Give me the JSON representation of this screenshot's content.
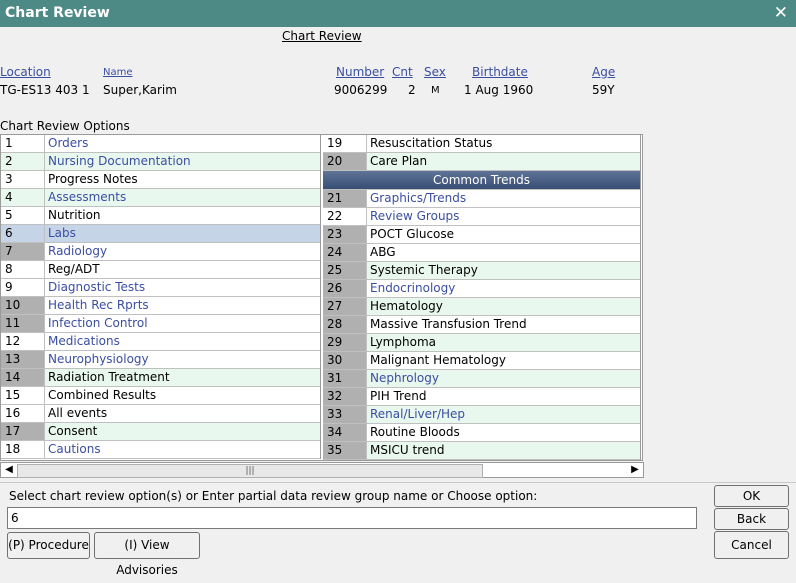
{
  "window": {
    "title": "Chart Review",
    "close_glyph": "✕"
  },
  "heading": "Chart Review",
  "patient": {
    "headers": {
      "location": "Location",
      "name": "Name",
      "number": "Number",
      "cnt": "Cnt",
      "sex": "Sex",
      "birthdate": "Birthdate",
      "age": "Age"
    },
    "values": {
      "location": "TG-ES13 403 1",
      "name": "Super,Karim",
      "number": "9006299",
      "cnt": "2",
      "sex": "M",
      "birthdate": "1 Aug 1960",
      "age": "59Y"
    }
  },
  "options_label": "Chart Review Options",
  "left_options": [
    {
      "num": "1",
      "label": "Orders",
      "link": true,
      "shade": false,
      "gray": false
    },
    {
      "num": "2",
      "label": "Nursing Documentation",
      "link": true,
      "shade": true,
      "gray": false
    },
    {
      "num": "3",
      "label": "Progress Notes",
      "link": false,
      "shade": false,
      "gray": false
    },
    {
      "num": "4",
      "label": "Assessments",
      "link": true,
      "shade": true,
      "gray": false
    },
    {
      "num": "5",
      "label": "Nutrition",
      "link": false,
      "shade": false,
      "gray": false
    },
    {
      "num": "6",
      "label": "Labs",
      "link": true,
      "shade": false,
      "gray": false,
      "selected": true
    },
    {
      "num": "7",
      "label": "Radiology",
      "link": true,
      "shade": false,
      "gray": true
    },
    {
      "num": "8",
      "label": "Reg/ADT",
      "link": false,
      "shade": false,
      "gray": false
    },
    {
      "num": "9",
      "label": "Diagnostic Tests",
      "link": true,
      "shade": false,
      "gray": false
    },
    {
      "num": "10",
      "label": "Health Rec Rprts",
      "link": true,
      "shade": false,
      "gray": true
    },
    {
      "num": "11",
      "label": "Infection Control",
      "link": true,
      "shade": false,
      "gray": true
    },
    {
      "num": "12",
      "label": "Medications",
      "link": true,
      "shade": false,
      "gray": false
    },
    {
      "num": "13",
      "label": "Neurophysiology",
      "link": true,
      "shade": false,
      "gray": true
    },
    {
      "num": "14",
      "label": "Radiation Treatment",
      "link": false,
      "shade": true,
      "gray": true
    },
    {
      "num": "15",
      "label": "Combined Results",
      "link": false,
      "shade": false,
      "gray": false
    },
    {
      "num": "16",
      "label": "All events",
      "link": false,
      "shade": false,
      "gray": false
    },
    {
      "num": "17",
      "label": "Consent",
      "link": false,
      "shade": true,
      "gray": true
    },
    {
      "num": "18",
      "label": "Cautions",
      "link": true,
      "shade": false,
      "gray": false
    }
  ],
  "right_options_top": [
    {
      "num": "19",
      "label": "Resuscitation Status",
      "link": false,
      "shade": false,
      "gray": false
    },
    {
      "num": "20",
      "label": "Care Plan",
      "link": false,
      "shade": true,
      "gray": true
    }
  ],
  "common_trends_header": "Common Trends",
  "right_options": [
    {
      "num": "21",
      "label": "Graphics/Trends",
      "link": true,
      "shade": false,
      "gray": true
    },
    {
      "num": "22",
      "label": "Review Groups",
      "link": true,
      "shade": false,
      "gray": false
    },
    {
      "num": "23",
      "label": "POCT Glucose",
      "link": false,
      "shade": false,
      "gray": true
    },
    {
      "num": "24",
      "label": "ABG",
      "link": false,
      "shade": false,
      "gray": true
    },
    {
      "num": "25",
      "label": "Systemic Therapy",
      "link": false,
      "shade": true,
      "gray": true
    },
    {
      "num": "26",
      "label": "Endocrinology",
      "link": true,
      "shade": false,
      "gray": true
    },
    {
      "num": "27",
      "label": "Hematology",
      "link": false,
      "shade": true,
      "gray": true
    },
    {
      "num": "28",
      "label": "Massive Transfusion Trend",
      "link": false,
      "shade": false,
      "gray": true
    },
    {
      "num": "29",
      "label": "Lymphoma",
      "link": false,
      "shade": true,
      "gray": true
    },
    {
      "num": "30",
      "label": "Malignant Hematology",
      "link": false,
      "shade": false,
      "gray": true
    },
    {
      "num": "31",
      "label": "Nephrology",
      "link": true,
      "shade": true,
      "gray": true
    },
    {
      "num": "32",
      "label": "PIH Trend",
      "link": false,
      "shade": false,
      "gray": true
    },
    {
      "num": "33",
      "label": "Renal/Liver/Hep",
      "link": true,
      "shade": true,
      "gray": true
    },
    {
      "num": "34",
      "label": "Routine Bloods",
      "link": false,
      "shade": false,
      "gray": true
    },
    {
      "num": "35",
      "label": "MSICU trend",
      "link": false,
      "shade": true,
      "gray": true
    }
  ],
  "scroll_grip": "|||",
  "prompt_label": "Select chart review option(s) or Enter partial data review group name or Choose option:",
  "input_value": "6",
  "buttons": {
    "ok": "OK",
    "back": "Back",
    "cancel": "Cancel",
    "procedure": "(P) Procedure",
    "advisories": "(I) View Advisories"
  },
  "colors": {
    "titlebar": "#4d8a86",
    "link": "#3a4ea0",
    "shade": "#e9f8ee",
    "selected": "#c6d4e8"
  }
}
